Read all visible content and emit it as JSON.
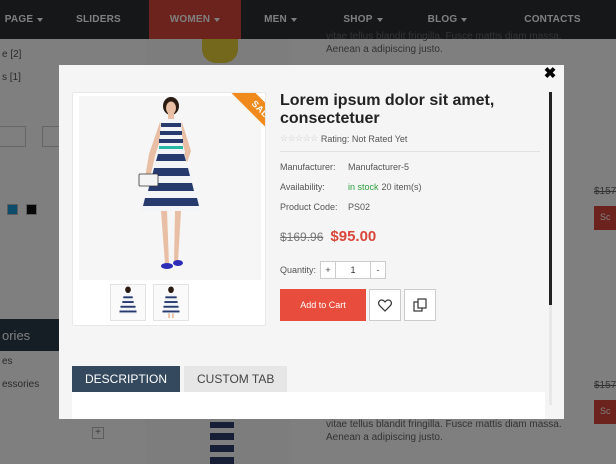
{
  "nav": {
    "items": [
      {
        "label": "PAGE",
        "caret": true,
        "active": false
      },
      {
        "label": "SLIDERS",
        "caret": false,
        "active": false
      },
      {
        "label": "WOMEN",
        "caret": true,
        "active": true
      },
      {
        "label": "MEN",
        "caret": true,
        "active": false
      },
      {
        "label": "SHOP",
        "caret": true,
        "active": false
      },
      {
        "label": "BLOG",
        "caret": true,
        "active": false
      },
      {
        "label": "CONTACTS",
        "caret": false,
        "active": false
      }
    ]
  },
  "background": {
    "filter_counts": [
      "e [2]",
      "s [1]"
    ],
    "category_heading": "ories",
    "category_links": [
      "es",
      "essories"
    ],
    "plus_label": "+",
    "desc_top": [
      "vitae tellus blandit fringilla. Fusce mattis diam massa.",
      "Aenean a adipiscing justo."
    ],
    "desc_bottom": [
      "vitae tellus blandit fringilla. Fusce mattis diam massa.",
      "Aenean a adipiscing justo."
    ],
    "old_price_partial": "$157",
    "btn_partial": "Sc"
  },
  "modal": {
    "close_icon": "close-icon",
    "sale_badge": "SALE",
    "title": "Lorem ipsum dolor sit amet, consectetuer",
    "rating_stars": "☆☆☆☆☆",
    "rating_text": "Rating: Not Rated Yet",
    "specs": {
      "manufacturer_label": "Manufacturer:",
      "manufacturer_value": "Manufacturer-5",
      "availability_label": "Availability:",
      "availability_status": "in stock",
      "availability_count": "20 item(s)",
      "code_label": "Product Code:",
      "code_value": "PS02"
    },
    "old_price": "$169.96",
    "new_price": "$95.00",
    "quantity_label": "Quantity:",
    "qty_plus": "+",
    "qty_value": "1",
    "qty_minus": "-",
    "add_to_cart": "Add to Cart",
    "tabs": [
      "DESCRIPTION",
      "CUSTOM TAB"
    ]
  },
  "colors": {
    "accent": "#d9463b",
    "nav_bg": "#2b2f33",
    "tab_active": "#34495e",
    "in_stock": "#2e9e3e",
    "sale": "#f08a1c"
  }
}
